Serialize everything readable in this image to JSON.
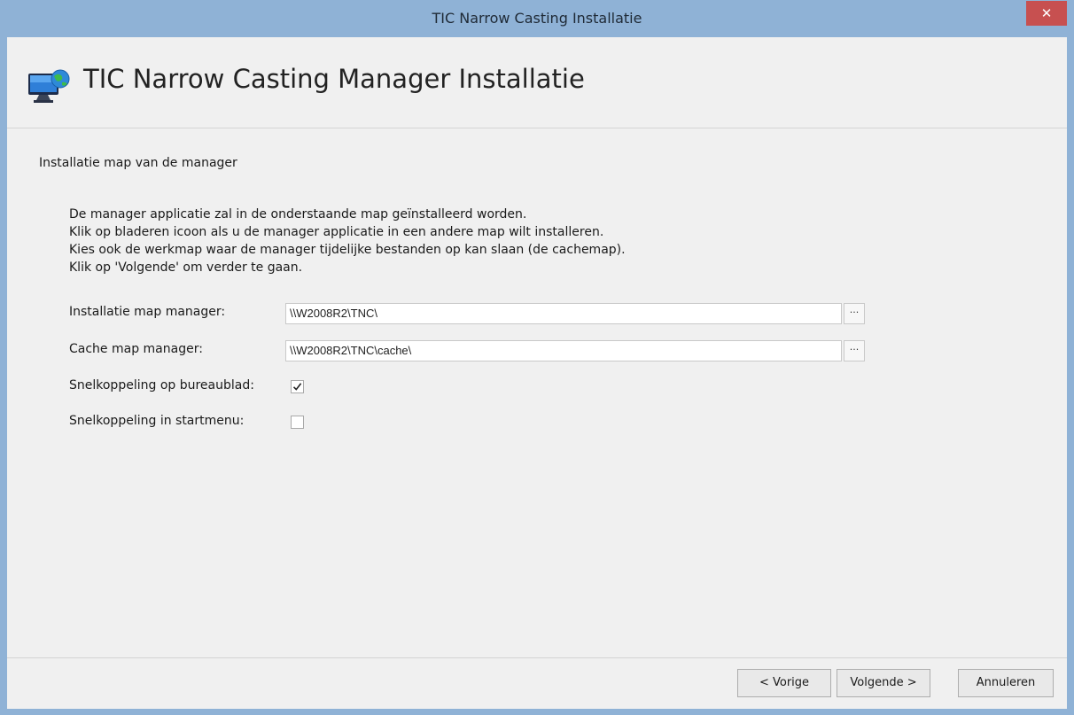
{
  "window": {
    "title": "TIC Narrow Casting Installatie",
    "close_glyph": "✕"
  },
  "header": {
    "icon": "monitor-globe-icon",
    "heading": "TIC Narrow Casting Manager Installatie"
  },
  "section": {
    "title": "Installatie map van de manager",
    "description_lines": [
      "De manager applicatie zal in de onderstaande map geïnstalleerd worden.",
      "Klik op bladeren icoon als u de manager applicatie in een andere map wilt installeren.",
      "Kies ook de werkmap waar de manager tijdelijke bestanden op kan slaan (de cachemap).",
      "Klik op 'Volgende' om verder te gaan."
    ]
  },
  "fields": {
    "install_dir": {
      "label": "Installatie map manager:",
      "value": "\\\\W2008R2\\TNC\\",
      "browse_label": "···"
    },
    "cache_dir": {
      "label": "Cache map manager:",
      "value": "\\\\W2008R2\\TNC\\cache\\",
      "browse_label": "···"
    },
    "desktop_shortcut": {
      "label": "Snelkoppeling op bureaublad:",
      "checked": true
    },
    "startmenu_shortcut": {
      "label": "Snelkoppeling in startmenu:",
      "checked": false
    }
  },
  "buttons": {
    "previous": "< Vorige",
    "next": "Volgende >",
    "cancel": "Annuleren"
  },
  "colors": {
    "titlebar": "#8fb2d6",
    "close_button": "#c75050",
    "client_background": "#f0f0f0"
  }
}
